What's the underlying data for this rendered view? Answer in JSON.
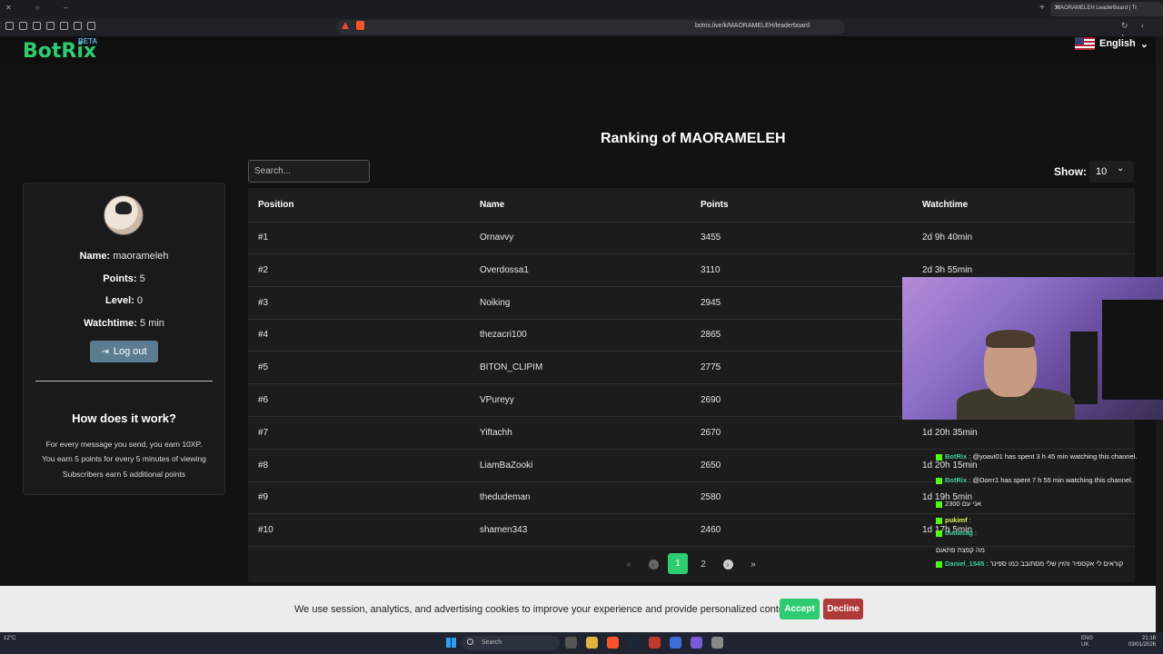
{
  "browser": {
    "tab_title": "MAORAMELEH LeaderBoard | Tr",
    "url": "botrix.live/k/MAORAMELEH/leaderboard"
  },
  "header": {
    "logo": "BotRix",
    "logo_badge": "BETA",
    "language": "English"
  },
  "page_title": "Ranking of MAORAMELEH",
  "search": {
    "placeholder": "Search..."
  },
  "show": {
    "label": "Show:",
    "value": "10"
  },
  "profile": {
    "name_label": "Name:",
    "name": "maorameleh",
    "points_label": "Points:",
    "points": "5",
    "level_label": "Level:",
    "level": "0",
    "watchtime_label": "Watchtime:",
    "watchtime": "5 min",
    "logout_label": "Log out"
  },
  "how": {
    "title": "How does it work?",
    "lines": [
      "For every message you send, you earn 10XP.",
      "You earn 5 points for every 5 minutes of viewing",
      "Subscribers earn 5 additional points"
    ]
  },
  "table": {
    "columns": [
      "Position",
      "Name",
      "Points",
      "Watchtime"
    ],
    "rows": [
      {
        "position": "#1",
        "name": "Ornavvy",
        "points": "3455",
        "watchtime": "2d 9h 40min"
      },
      {
        "position": "#2",
        "name": "Overdossa1",
        "points": "3110",
        "watchtime": "2d 3h 55min"
      },
      {
        "position": "#3",
        "name": "Noiking",
        "points": "2945",
        "watchtime": ""
      },
      {
        "position": "#4",
        "name": "thezacri100",
        "points": "2865",
        "watchtime": ""
      },
      {
        "position": "#5",
        "name": "BITON_CLIPIM",
        "points": "2775",
        "watchtime": ""
      },
      {
        "position": "#6",
        "name": "VPureyy",
        "points": "2690",
        "watchtime": ""
      },
      {
        "position": "#7",
        "name": "Yiftachh",
        "points": "2670",
        "watchtime": "1d 20h 35min"
      },
      {
        "position": "#8",
        "name": "LiamBaZooki",
        "points": "2650",
        "watchtime": "1d 20h 15min"
      },
      {
        "position": "#9",
        "name": "thedudeman",
        "points": "2580",
        "watchtime": "1d 19h 5min"
      },
      {
        "position": "#10",
        "name": "shamen343",
        "points": "2460",
        "watchtime": "1d 17h 5min"
      }
    ]
  },
  "pagination": {
    "pages": [
      "1",
      "2"
    ],
    "current": "1"
  },
  "chat": [
    {
      "user": "BotRix",
      "user_color": "#3ed0a0",
      "text": ": @yoavi01 has spent 3 h 45 min watching this channel."
    },
    {
      "user": "BotRix",
      "user_color": "#3ed0a0",
      "text": ": @Dorrr1 has spent 7 h 55 min watching this channel."
    },
    {
      "user": "",
      "user_color": "#5d8cf0",
      "text": "אני עם 2300"
    },
    {
      "user": "pukimf",
      "user_color": "#d9f55a",
      "text": ":"
    },
    {
      "user": "dudasag",
      "user_color": "#3ed0a0",
      "text": ":"
    },
    {
      "user": "",
      "user_color": "#ffffff",
      "text": "מה קפצת פתאום"
    },
    {
      "user": "Daniel_1545",
      "user_color": "#3ed0a0",
      "text": ": קוראים לי אקספיר והזין שלי מסתובב כמו ספינר"
    }
  ],
  "cookie": {
    "text": "We use session, analytics, and advertising cookies to improve your experience and provide personalized content.",
    "accept": "Accept",
    "decline": "Decline"
  },
  "taskbar": {
    "temp": "12°C",
    "search_placeholder": "Search",
    "time": "21:16",
    "date": "03/01/2026",
    "lang_top": "ENG",
    "lang_bottom": "UK"
  }
}
